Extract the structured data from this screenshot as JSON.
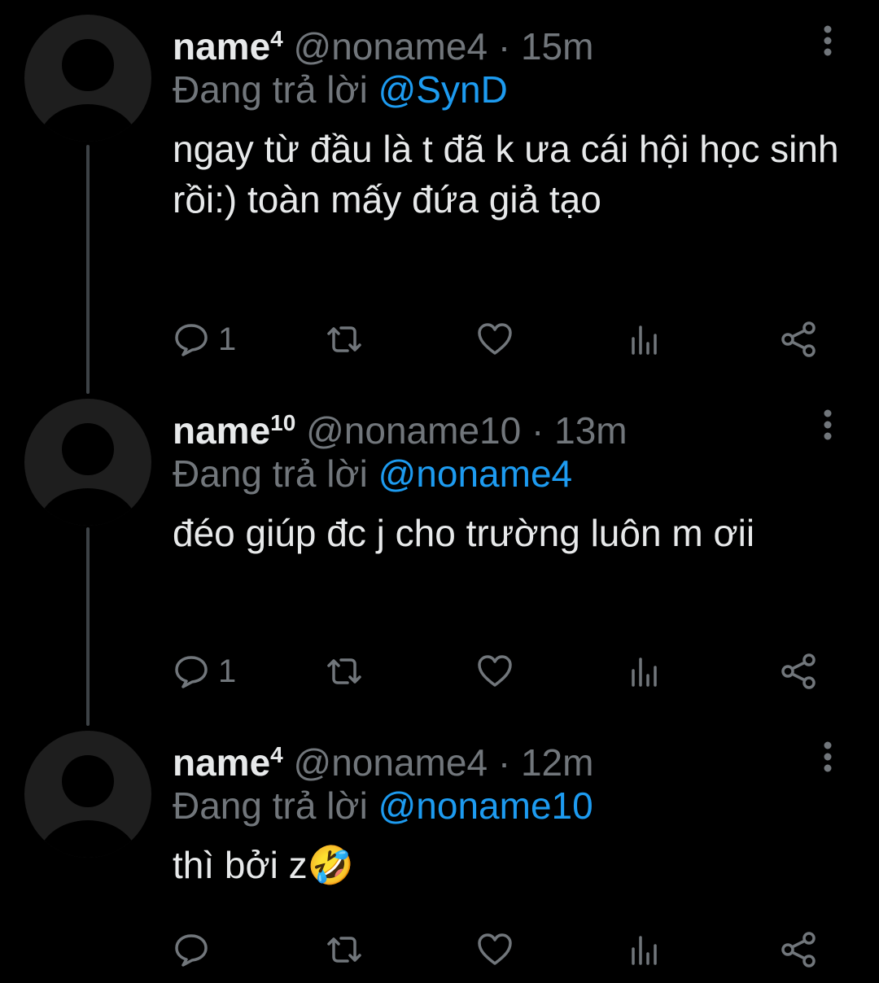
{
  "tweets": [
    {
      "name": "name",
      "name_sup": "4",
      "handle": "@noname4",
      "separator": "·",
      "time": "15m",
      "reply_prefix": "Đang trả lời",
      "reply_to": "@SynD",
      "text": "ngay từ đầu là t đã k ưa cái hội học sinh rồi:) toàn mấy đứa giả tạo",
      "reply_count": "1"
    },
    {
      "name": "name",
      "name_sup": "10",
      "handle": "@noname10",
      "separator": "·",
      "time": "13m",
      "reply_prefix": "Đang trả lời",
      "reply_to": "@noname4",
      "text": "đéo giúp đc j cho trường luôn m ơii",
      "reply_count": "1"
    },
    {
      "name": "name",
      "name_sup": "4",
      "handle": "@noname4",
      "separator": "·",
      "time": "12m",
      "reply_prefix": "Đang trả lời",
      "reply_to": "@noname10",
      "text": "thì bởi z🤣",
      "reply_count": ""
    }
  ],
  "icons": {
    "reply": "reply-icon",
    "retweet": "retweet-icon",
    "like": "heart-icon",
    "views": "analytics-icon",
    "share": "share-icon",
    "more": "more-vertical-icon"
  },
  "colors": {
    "background": "#000000",
    "text": "#e7e9ea",
    "muted": "#71767b",
    "link": "#1d9bf0",
    "avatar_bg": "#1e1e1e",
    "avatar_fg": "#000000"
  }
}
